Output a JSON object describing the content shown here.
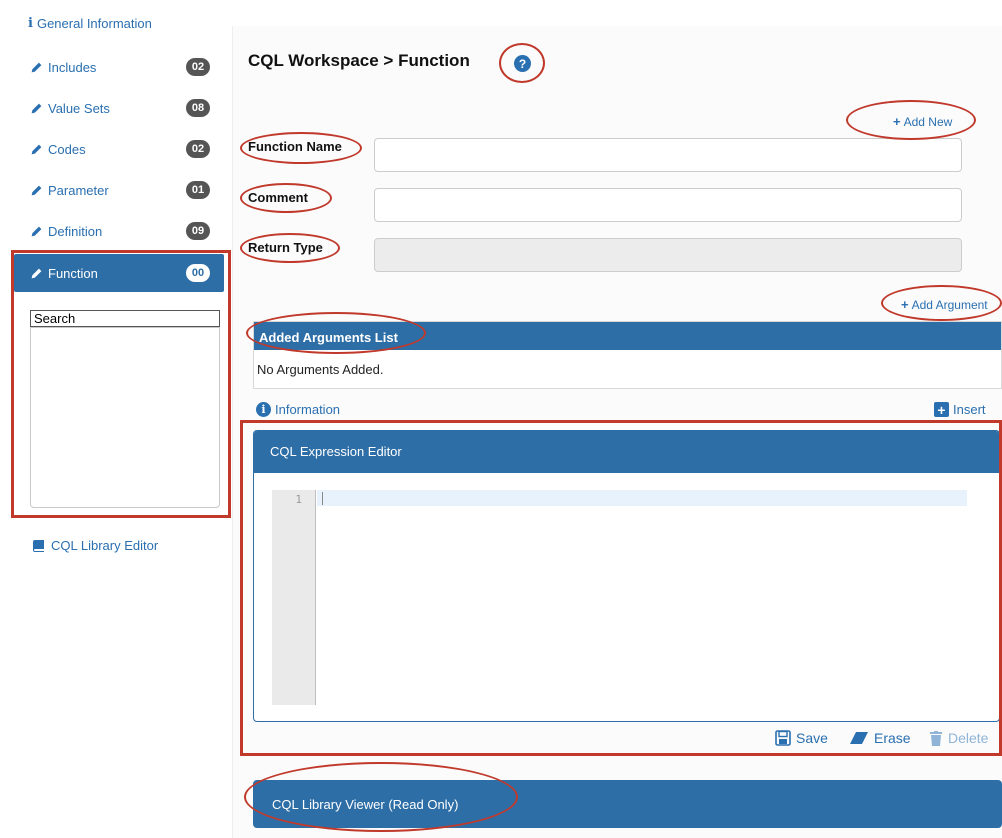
{
  "sidebar": {
    "general_info": "General Information",
    "items": [
      {
        "label": "Includes",
        "count": "02"
      },
      {
        "label": "Value Sets",
        "count": "08"
      },
      {
        "label": "Codes",
        "count": "02"
      },
      {
        "label": "Parameter",
        "count": "01"
      },
      {
        "label": "Definition",
        "count": "09"
      },
      {
        "label": "Function",
        "count": "00"
      }
    ],
    "active_item": "Function",
    "search_value": "Search",
    "library_editor": "CQL Library Editor"
  },
  "main": {
    "title": "CQL Workspace > Function",
    "add_new": "Add New",
    "fields": {
      "function_name": "Function Name",
      "comment": "Comment",
      "return_type": "Return Type"
    },
    "add_argument": "Add Argument",
    "args_header": "Added Arguments List",
    "args_empty": "No Arguments Added.",
    "information": "Information",
    "insert": "Insert",
    "editor_title": "CQL Expression Editor",
    "editor_line": "1",
    "actions": {
      "save": "Save",
      "erase": "Erase",
      "delete": "Delete"
    },
    "viewer_title": "CQL Library Viewer (Read Only)"
  },
  "colors": {
    "accent": "#2e6ea6",
    "link": "#2a6fb0",
    "annotation": "#c0392b"
  },
  "icons": [
    "info-icon",
    "pencil-icon",
    "book-icon",
    "help-icon",
    "plus-icon",
    "save-icon",
    "eraser-icon",
    "trash-icon"
  ]
}
